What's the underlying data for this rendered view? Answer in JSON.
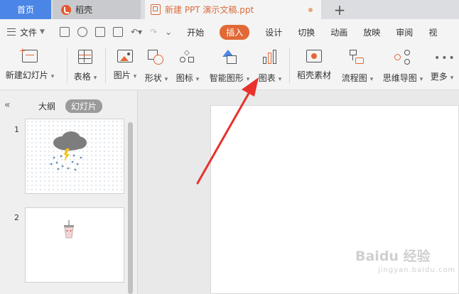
{
  "tabs": {
    "home": "首页",
    "daoke": "稻壳",
    "document": "新建 PPT 演示文稿.ppt",
    "new_tab": "+"
  },
  "menubar": {
    "file": "文件",
    "tabs": [
      "开始",
      "插入",
      "设计",
      "切换",
      "动画",
      "放映",
      "审阅",
      "视"
    ],
    "active_tab": "插入"
  },
  "ribbon": {
    "items": [
      {
        "label": "新建幻灯片",
        "icon": "new-slide-icon",
        "dropdown": true
      },
      {
        "label": "表格",
        "icon": "table-icon",
        "dropdown": true
      },
      {
        "label": "图片",
        "icon": "picture-icon",
        "dropdown": true
      },
      {
        "label": "形状",
        "icon": "shape-icon",
        "dropdown": true
      },
      {
        "label": "图标",
        "icon": "icons-icon",
        "dropdown": true
      },
      {
        "label": "智能图形",
        "icon": "smartart-icon",
        "dropdown": true
      },
      {
        "label": "图表",
        "icon": "chart-icon",
        "dropdown": true
      },
      {
        "label": "稻壳素材",
        "icon": "daoke-material-icon",
        "dropdown": false
      },
      {
        "label": "流程图",
        "icon": "flowchart-icon",
        "dropdown": true
      },
      {
        "label": "思维导图",
        "icon": "mindmap-icon",
        "dropdown": true
      },
      {
        "label": "更多",
        "icon": "more-icon",
        "dropdown": true
      }
    ]
  },
  "panel": {
    "collapse": "«",
    "outline_label": "大纲",
    "slides_label": "幻灯片",
    "slides": [
      {
        "number": "1",
        "content": "storm-cloud"
      },
      {
        "number": "2",
        "content": "cup"
      }
    ]
  },
  "watermark": {
    "main": "Baidu 经验",
    "sub": "jingyan.baidu.com"
  },
  "colors": {
    "accent": "#e26936",
    "home_tab": "#4b86e7",
    "arrow": "#e8322d"
  }
}
